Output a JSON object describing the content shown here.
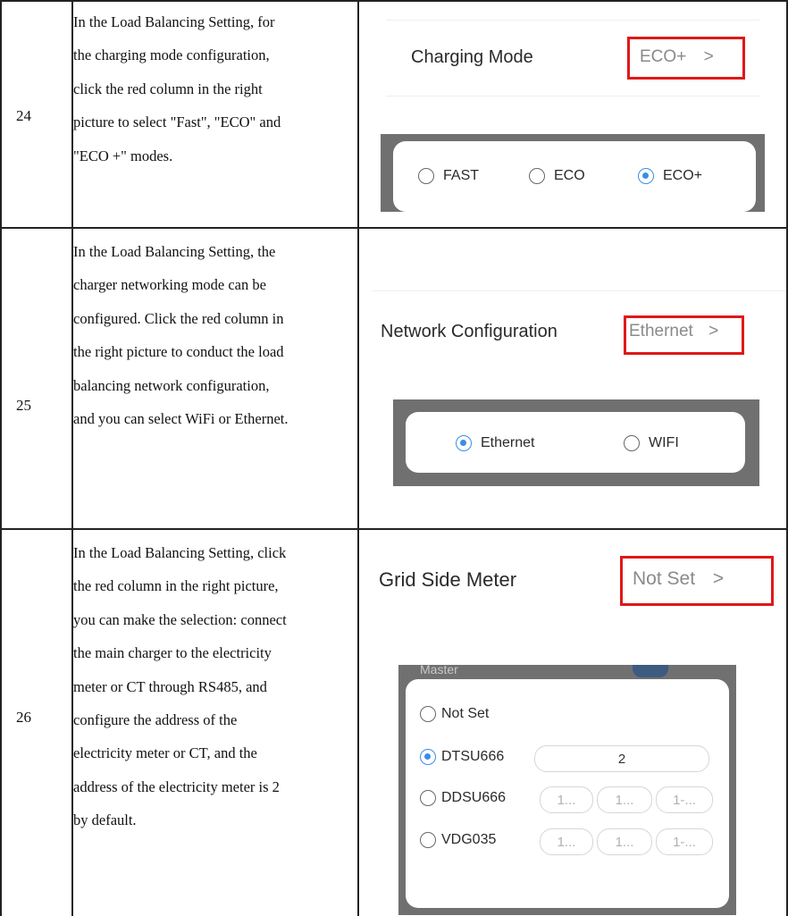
{
  "rows": [
    {
      "number": "24",
      "lines": [
        "In the Load Balancing Setting, for",
        "the charging mode configuration,",
        "click the red column in the right",
        "picture to select \"Fast\", \"ECO\" and",
        "\"ECO +\" modes."
      ],
      "setting": {
        "label": "Charging Mode",
        "value": "ECO+",
        "chevron": ">"
      },
      "options": [
        {
          "label": "FAST",
          "selected": false
        },
        {
          "label": "ECO",
          "selected": false
        },
        {
          "label": "ECO+",
          "selected": true
        }
      ]
    },
    {
      "number": "25",
      "lines": [
        "In the Load Balancing Setting, the",
        "charger networking mode can be",
        "configured. Click the red column in",
        "the right picture to conduct the load",
        "balancing network configuration,",
        "and you can select WiFi or Ethernet."
      ],
      "setting": {
        "label": "Network Configuration",
        "value": "Ethernet",
        "chevron": ">"
      },
      "options": [
        {
          "label": "Ethernet",
          "selected": true
        },
        {
          "label": "WIFI",
          "selected": false
        }
      ]
    },
    {
      "number": "26",
      "lines": [
        "In the Load Balancing Setting, click",
        "the red column in the right picture,",
        "you can make the selection: connect",
        "the main charger to the electricity",
        "meter or CT through RS485, and",
        "configure the address of the",
        "electricity meter or CT, and the",
        "address of the electricity meter is 2",
        "by default."
      ],
      "setting": {
        "label": "Grid Side Meter",
        "value": "Not Set",
        "chevron": ">"
      },
      "meters": [
        {
          "label": "Not Set",
          "selected": false,
          "fields": []
        },
        {
          "label": "DTSU666",
          "selected": true,
          "fields": [
            "2"
          ]
        },
        {
          "label": "DDSU666",
          "selected": false,
          "fields": [
            "1...",
            "1...",
            "1-..."
          ]
        },
        {
          "label": "VDG035",
          "selected": false,
          "fields": [
            "1...",
            "1...",
            "1-..."
          ]
        }
      ],
      "peek_text": "Master"
    }
  ],
  "colors": {
    "highlight": "#e01818",
    "accent": "#3a8ee6",
    "panel": "#707070"
  }
}
